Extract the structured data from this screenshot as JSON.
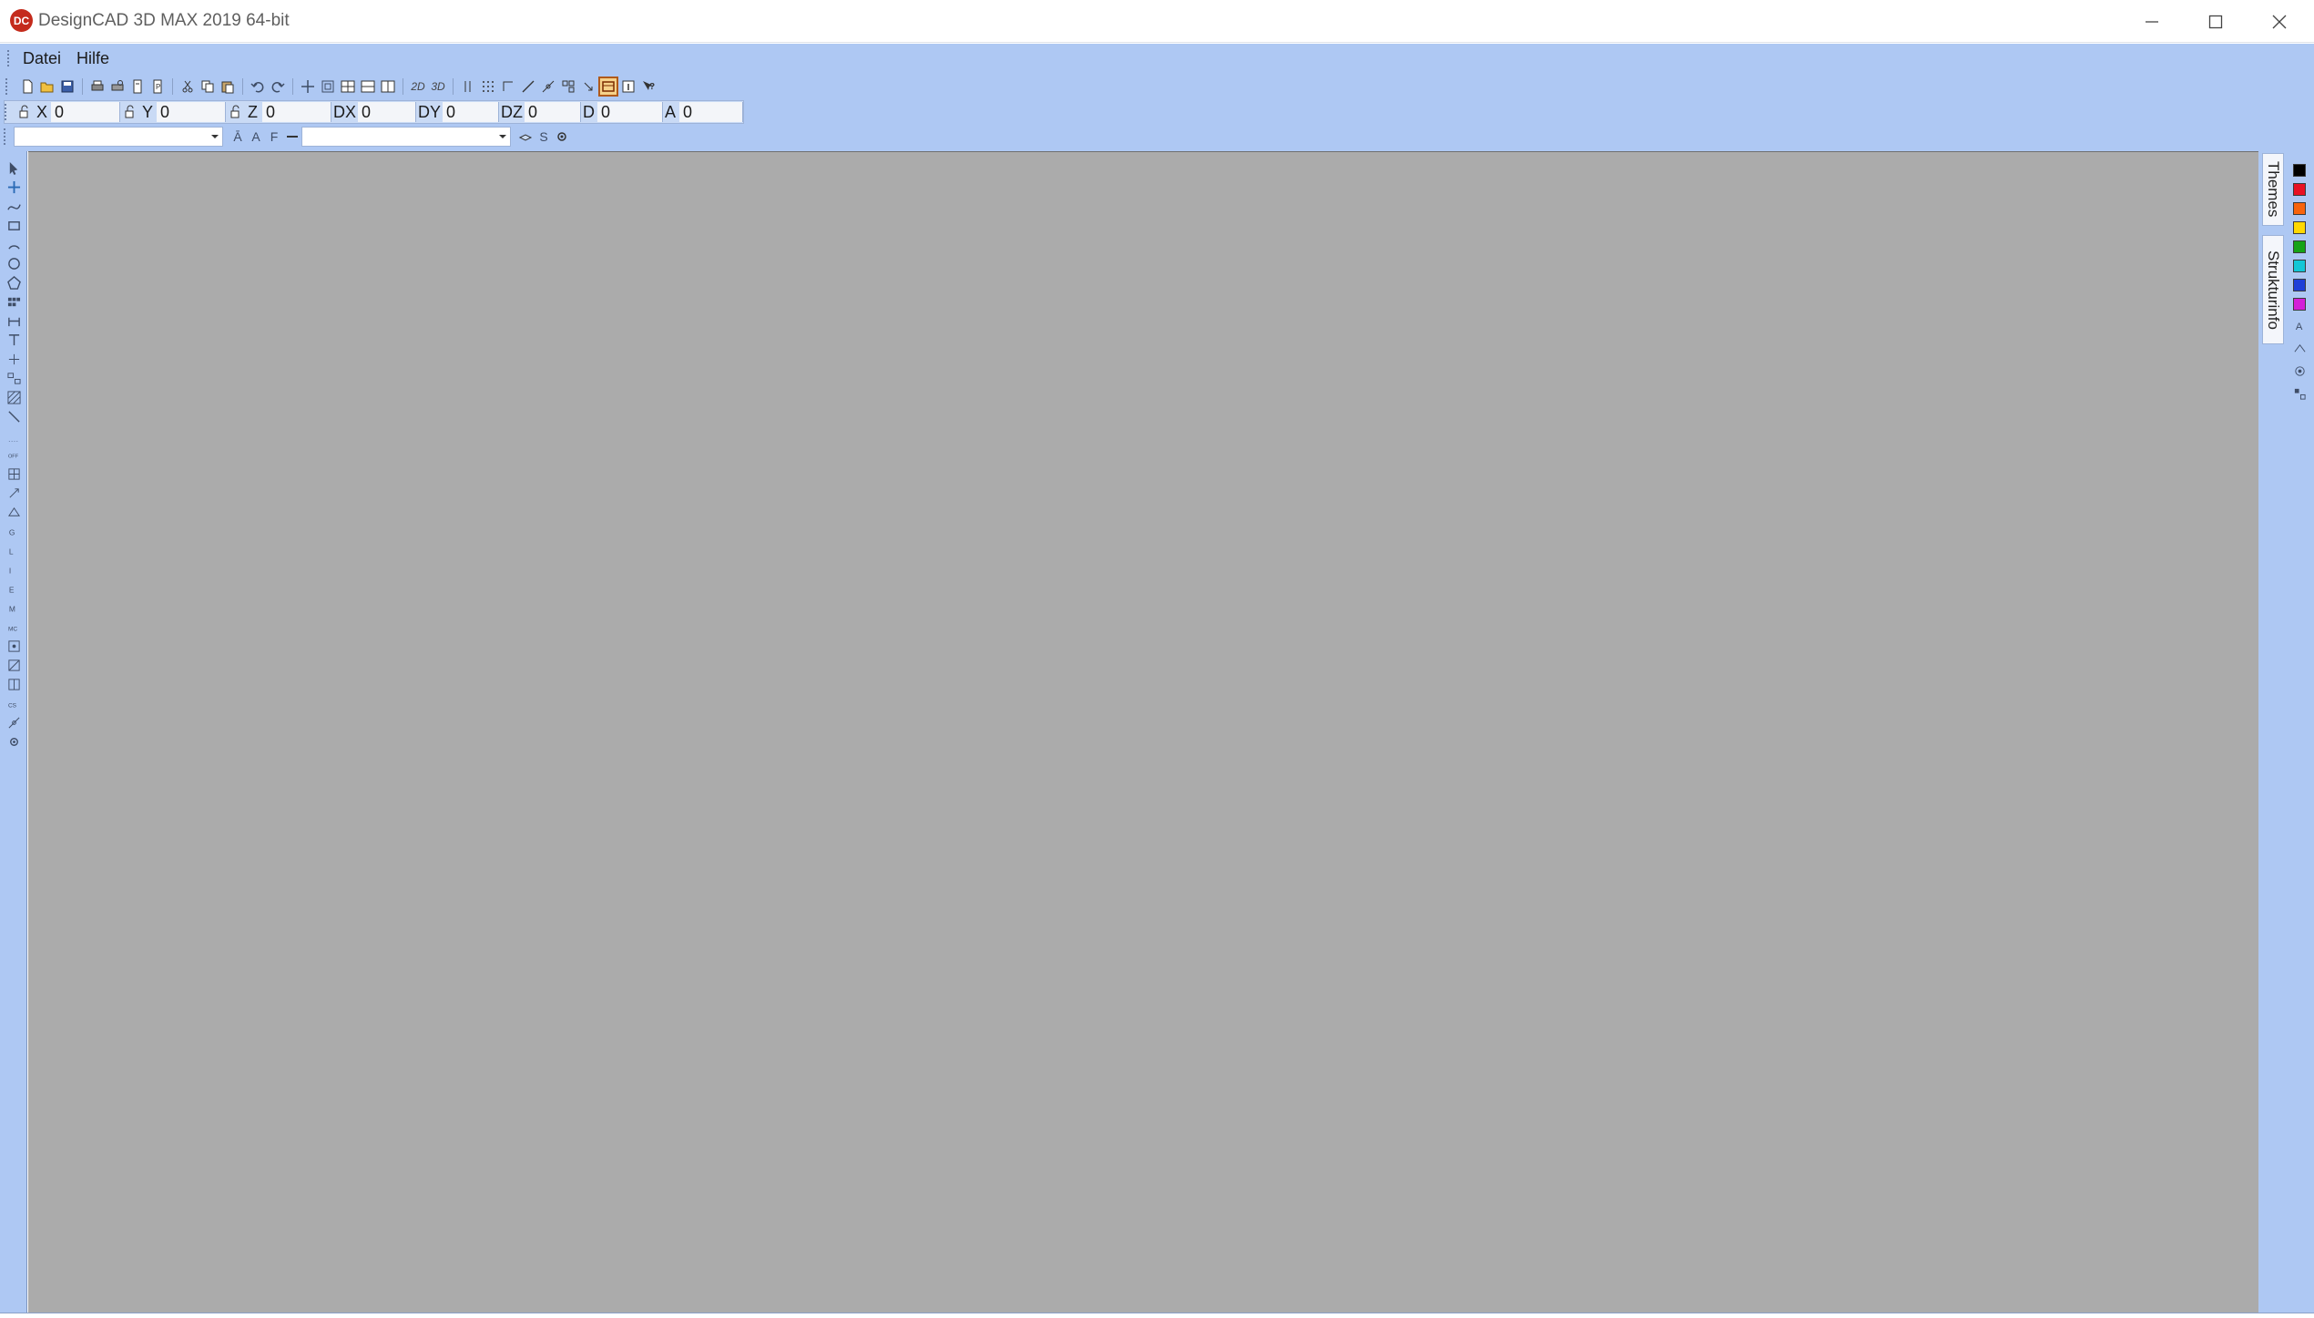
{
  "window": {
    "title": "DesignCAD 3D MAX 2019 64-bit",
    "app_icon_text": "DC",
    "controls": [
      "minimize",
      "maximize",
      "close"
    ]
  },
  "menu": {
    "items": [
      {
        "label": "Datei"
      },
      {
        "label": "Hilfe"
      }
    ]
  },
  "toolbar": {
    "mode_2d_label": "2D",
    "mode_3d_label": "3D"
  },
  "coordinates": {
    "x": {
      "label": "X",
      "value": "0"
    },
    "y": {
      "label": "Y",
      "value": "0"
    },
    "z": {
      "label": "Z",
      "value": "0"
    },
    "dx": {
      "label": "DX",
      "value": "0"
    },
    "dy": {
      "label": "DY",
      "value": "0"
    },
    "dz": {
      "label": "DZ",
      "value": "0"
    },
    "d": {
      "label": "D",
      "value": "0"
    },
    "a": {
      "label": "A",
      "value": "0"
    }
  },
  "style_bar": {
    "layer_combo_value": "",
    "style_combo_value": "",
    "font_icon_label": "F",
    "s_icon_label": "S"
  },
  "right_panel": {
    "tabs": [
      {
        "label": "Themes"
      },
      {
        "label": "Strukturinfo"
      }
    ],
    "colors": [
      "#000000",
      "#e81123",
      "#f7630c",
      "#ffd800",
      "#16a316",
      "#12c6d6",
      "#1e3fd8",
      "#d31fd8"
    ]
  },
  "icons": {
    "left_toolbar": [
      "select-icon",
      "move-icon",
      "curve-icon",
      "box-icon",
      "arc-icon",
      "circle-icon",
      "polygon-icon",
      "array-icon",
      "dimension-icon",
      "text-icon",
      "point-icon",
      "symbol-icon",
      "hatch-icon",
      "line-icon",
      "snap-off-icon",
      "snap-grid-icon",
      "snap-point-icon",
      "snap-surface-icon",
      "snap-g-icon",
      "snap-l-icon",
      "snap-i-icon",
      "snap-e-icon",
      "snap-m-icon",
      "snap-mc-icon",
      "snap-center-icon",
      "snap-tangent-icon",
      "snap-perp-icon",
      "snap-cs-icon",
      "snap-near-icon",
      "snap-settings-icon"
    ]
  }
}
